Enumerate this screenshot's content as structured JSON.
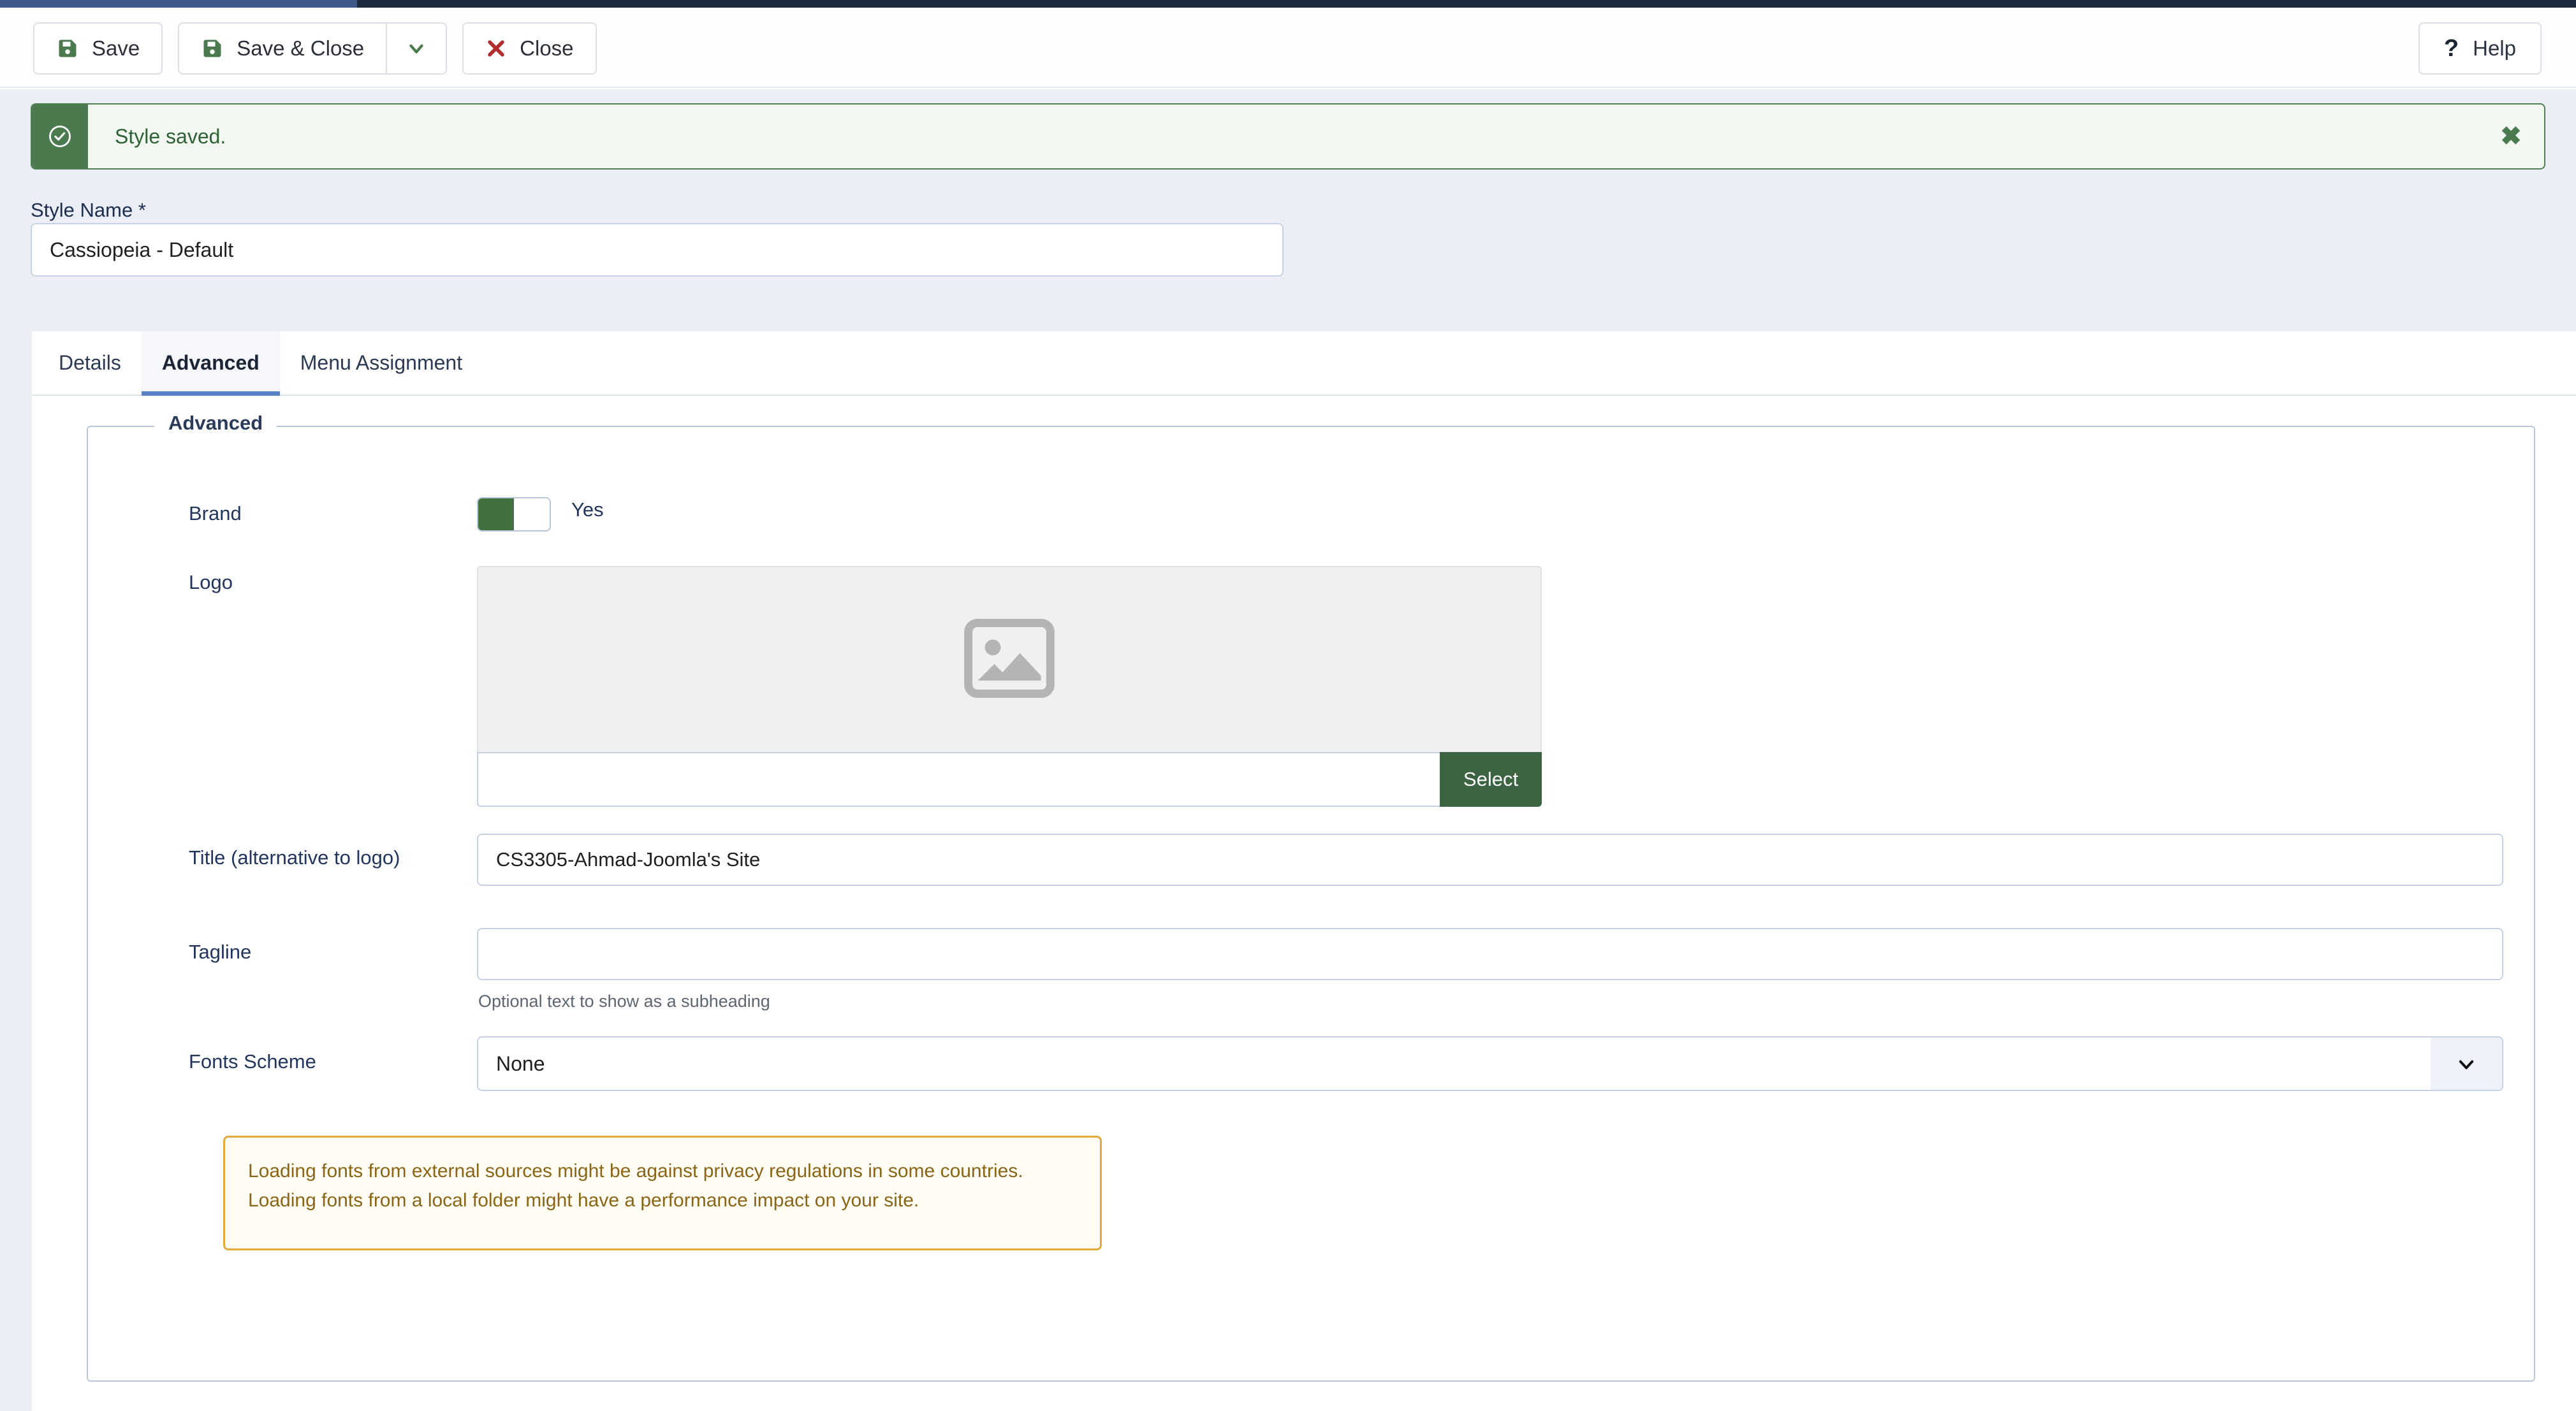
{
  "toolbar": {
    "save_label": "Save",
    "save_close_label": "Save & Close",
    "dropdown_caret": "chevron-down",
    "close_label": "Close",
    "help_label": "Help",
    "help_icon": "?"
  },
  "alert": {
    "icon": "check-circle-icon",
    "message": "Style saved.",
    "close": "✖",
    "accent_color": "#4a7a4e",
    "background": "#f2f7f2",
    "text_color": "#2e6135"
  },
  "style_name": {
    "label": "Style Name *",
    "value": "Cassiopeia - Default",
    "placeholder": ""
  },
  "tabs": [
    {
      "label": "Details",
      "active": false
    },
    {
      "label": "Advanced",
      "active": true
    },
    {
      "label": "Menu Assignment",
      "active": false
    }
  ],
  "fieldset": {
    "legend": "Advanced",
    "fields": {
      "brand": {
        "label": "Brand",
        "state_label": "Yes",
        "on": true,
        "on_color": "#41713f"
      },
      "logo": {
        "label": "Logo",
        "preview_icon": "image-placeholder-icon",
        "input_value": "",
        "select_label": "Select",
        "select_color": "#3c6443"
      },
      "title": {
        "label": "Title (alternative to logo)",
        "value": "CS3305-Ahmad-Joomla's Site",
        "placeholder": ""
      },
      "tagline": {
        "label": "Tagline",
        "value": "",
        "placeholder": "",
        "help": "Optional text to show as a subheading"
      },
      "fonts_scheme": {
        "label": "Fonts Scheme",
        "value": "None",
        "options": [
          "None"
        ],
        "arrow_icon": "chevron-down-icon"
      }
    },
    "notice": {
      "line1": "Loading fonts from external sources might be against privacy regulations in some countries.",
      "line2": "Loading fonts from a local folder might have a performance impact on your site.",
      "border_color": "#e5a83b",
      "text_color": "#8a6516"
    }
  }
}
